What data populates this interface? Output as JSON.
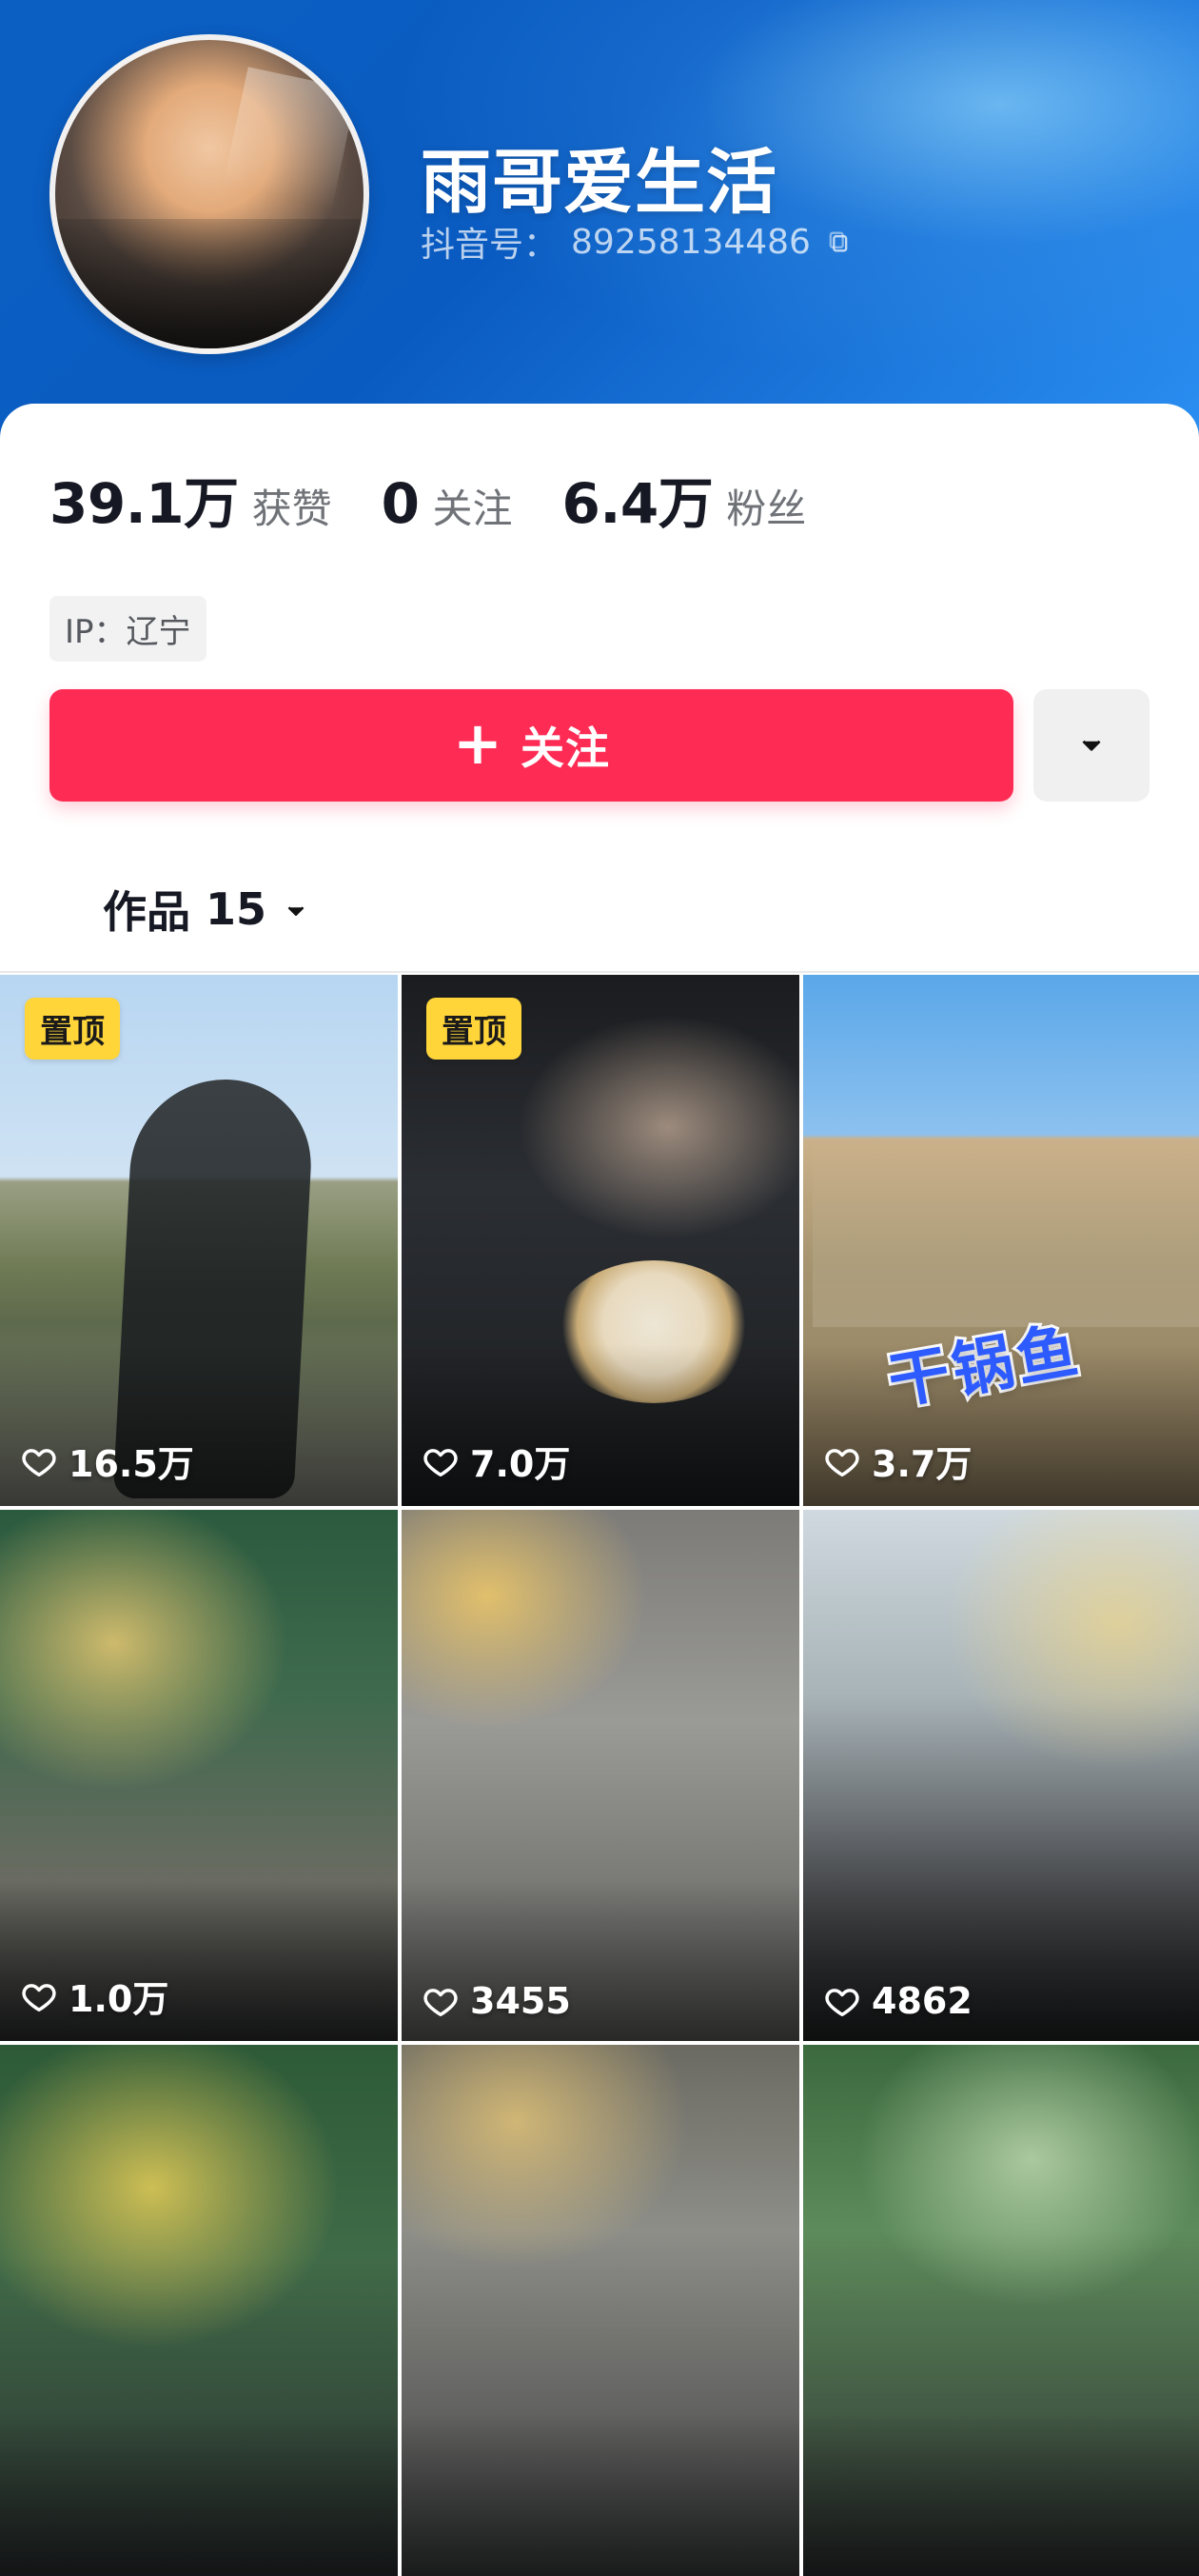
{
  "colors": {
    "accent": "#FE2C55",
    "pinned_badge": "#FFD53A",
    "header_blue_start": "#0B5FC2",
    "header_blue_end": "#2B8FF2"
  },
  "profile": {
    "name": "雨哥爱生活",
    "douyin_id_label": "抖音号：",
    "douyin_id": "89258134486",
    "copy_icon": "copy-icon"
  },
  "stats": [
    {
      "value": "39.1万",
      "label": "获赞"
    },
    {
      "value": "0",
      "label": "关注"
    },
    {
      "value": "6.4万",
      "label": "粉丝"
    }
  ],
  "ip": {
    "text": "IP：辽宁"
  },
  "actions": {
    "follow_label": "关注",
    "follow_plus": "+",
    "more_icon": "caret-down-icon"
  },
  "tabs": {
    "works_label": "作品",
    "works_count": "15",
    "tab_icon": "caret-down-icon"
  },
  "videos": [
    {
      "pinned": true,
      "pinned_label": "置顶",
      "likes": "16.5万",
      "overlay_text": "",
      "icon": "heart-icon"
    },
    {
      "pinned": true,
      "pinned_label": "置顶",
      "likes": "7.0万",
      "overlay_text": "",
      "icon": "heart-icon"
    },
    {
      "pinned": false,
      "pinned_label": "",
      "likes": "3.7万",
      "overlay_text": "干锅鱼",
      "icon": "heart-icon"
    },
    {
      "pinned": false,
      "pinned_label": "",
      "likes": "1.0万",
      "overlay_text": "",
      "icon": "heart-icon"
    },
    {
      "pinned": false,
      "pinned_label": "",
      "likes": "3455",
      "overlay_text": "",
      "icon": "heart-icon"
    },
    {
      "pinned": false,
      "pinned_label": "",
      "likes": "4862",
      "overlay_text": "",
      "icon": "heart-icon"
    },
    {
      "pinned": false,
      "pinned_label": "",
      "likes": "",
      "overlay_text": "",
      "icon": "heart-icon"
    },
    {
      "pinned": false,
      "pinned_label": "",
      "likes": "",
      "overlay_text": "",
      "icon": "heart-icon"
    },
    {
      "pinned": false,
      "pinned_label": "",
      "likes": "",
      "overlay_text": "",
      "icon": "heart-icon"
    }
  ]
}
